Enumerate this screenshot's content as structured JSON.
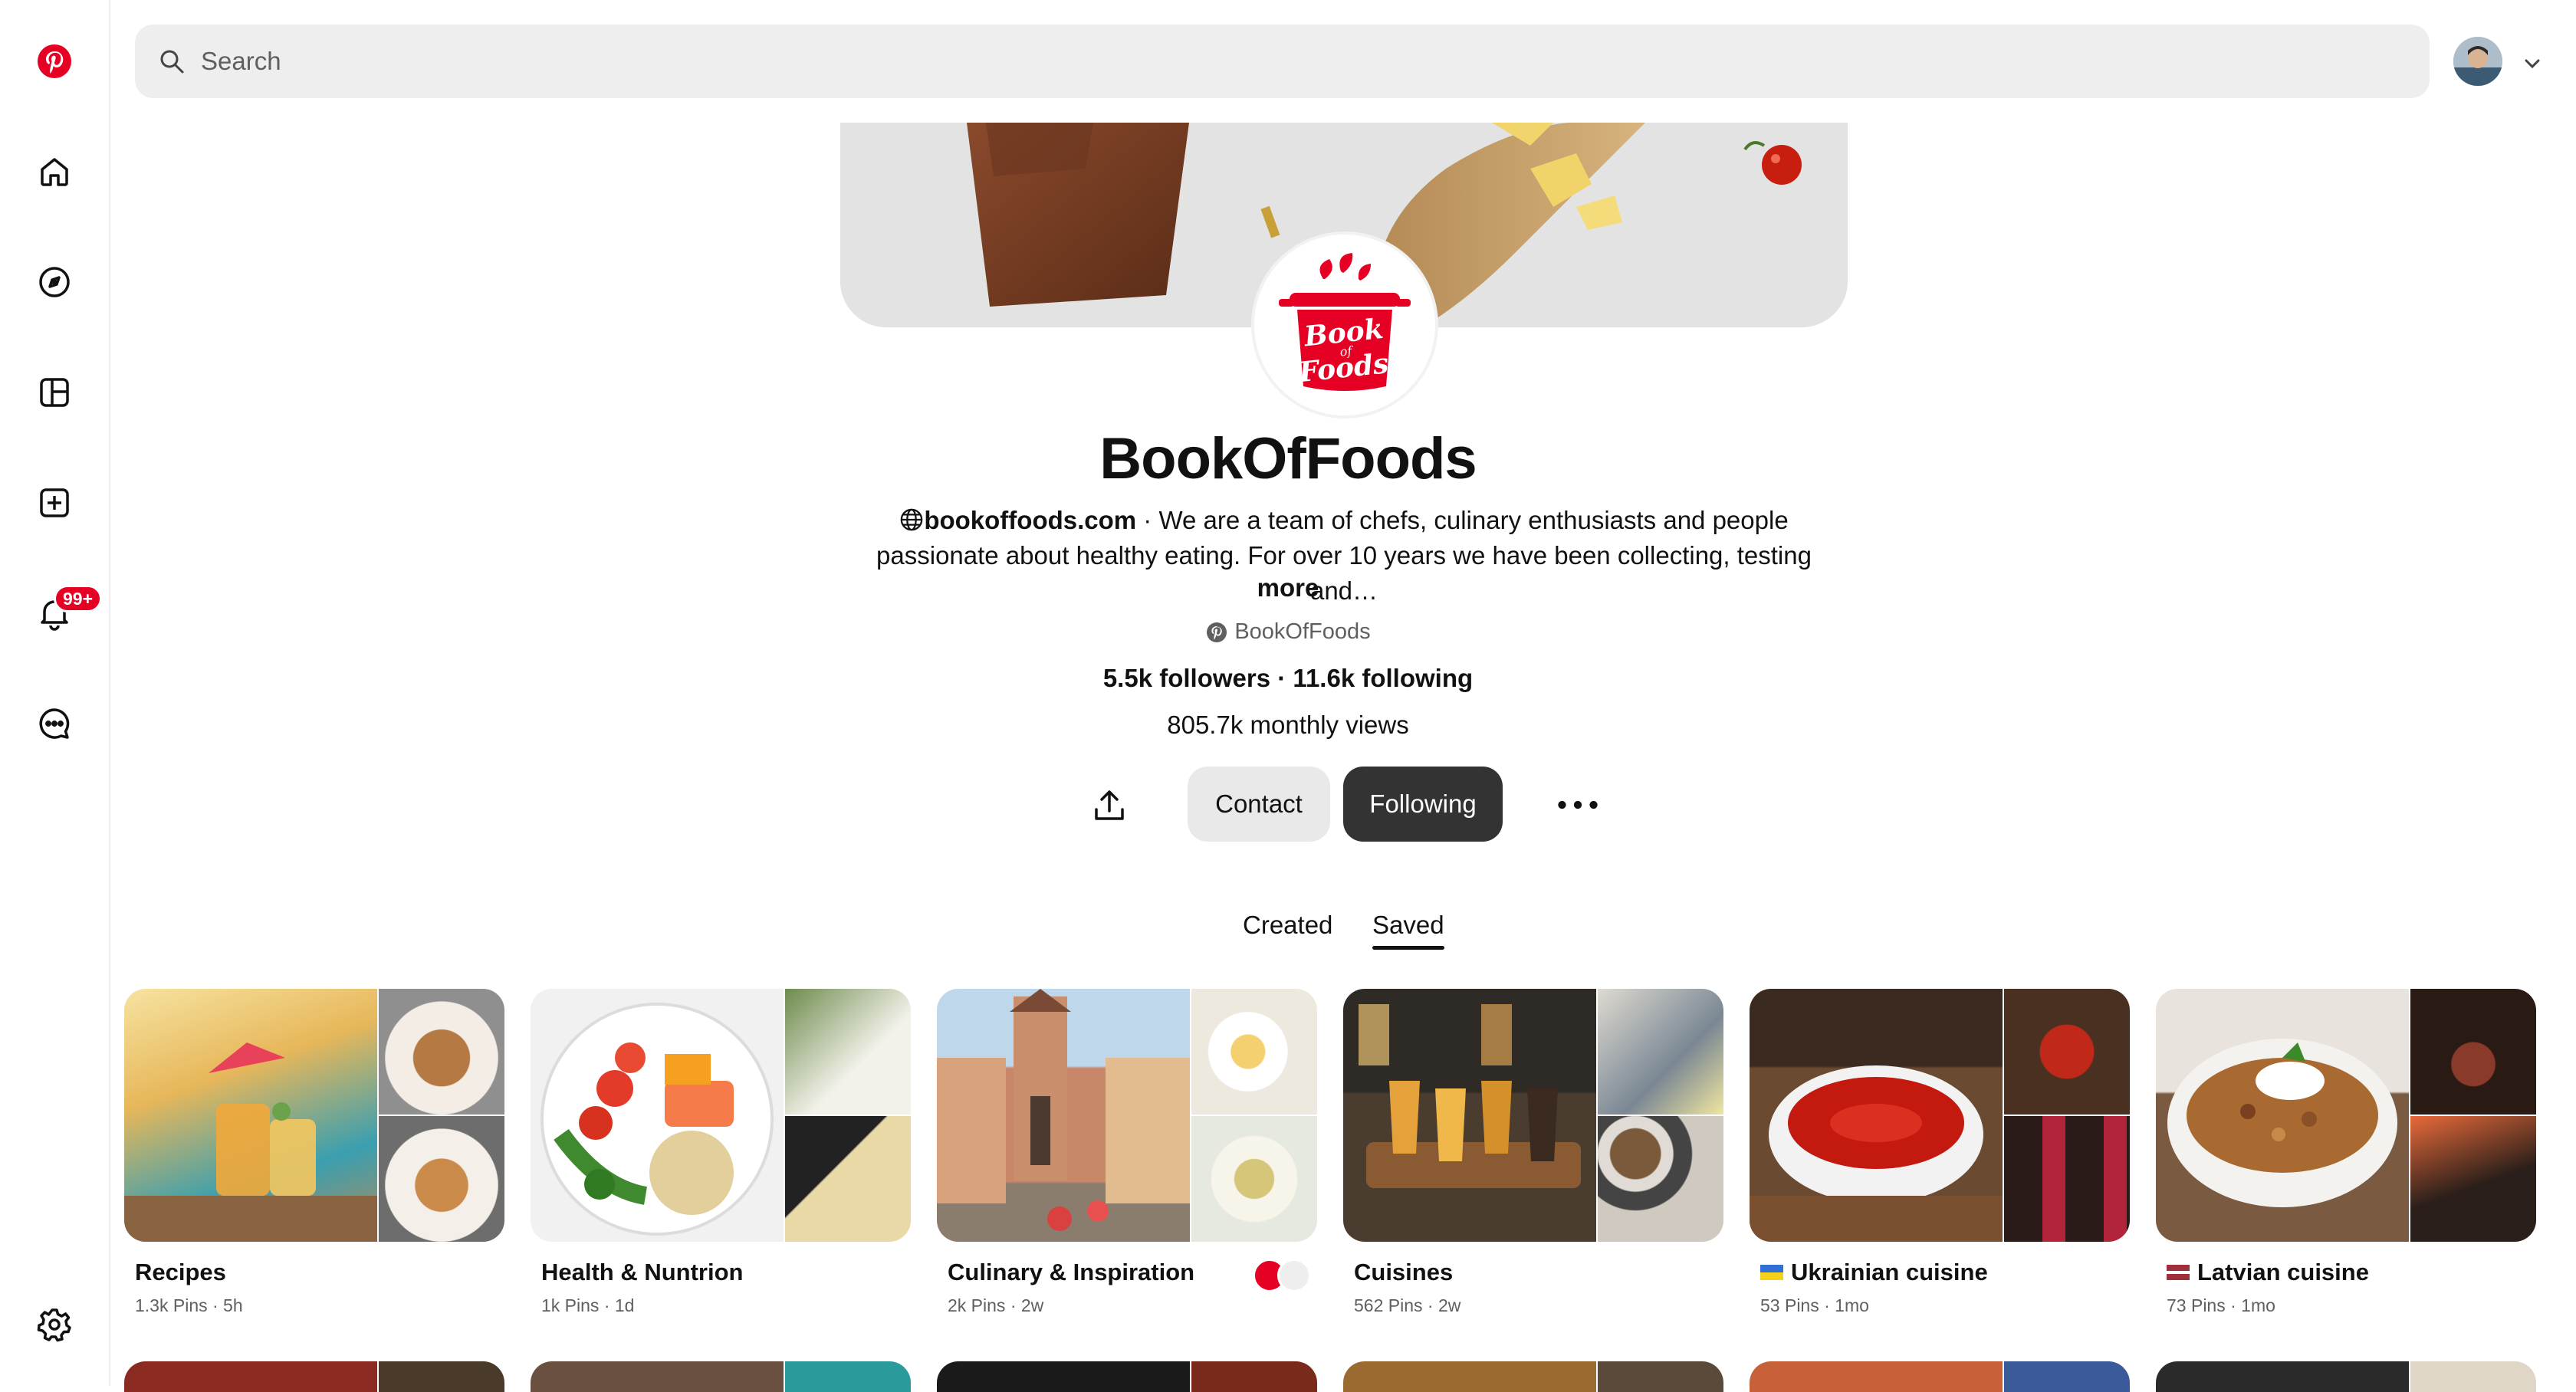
{
  "search": {
    "placeholder": "Search"
  },
  "nav": {
    "notifications_badge": "99+"
  },
  "profile": {
    "name": "BookOfFoods",
    "website": "bookoffoods.com",
    "bio_separator": " · ",
    "bio": "We are a team of chefs, culinary enthusiasts and people passionate about healthy eating. For over 10 years we have been collecting, testing and…",
    "more_label": "more",
    "handle": "BookOfFoods",
    "followers": "5.5k followers",
    "stats_separator": " · ",
    "following": "11.6k following",
    "monthly_views": "805.7k monthly views",
    "contact_label": "Contact",
    "following_button_label": "Following",
    "logo_text_top": "Book",
    "logo_text_mid": "of",
    "logo_text_bottom": "Foods"
  },
  "tabs": {
    "created": "Created",
    "saved": "Saved",
    "active": "Saved"
  },
  "boards": [
    {
      "title": "Recipes",
      "meta": "1.3k Pins · 5h"
    },
    {
      "title": "Health & Nuntrion",
      "meta": "1k Pins · 1d"
    },
    {
      "title": "Culinary & Inspiration",
      "meta": "2k Pins · 2w"
    },
    {
      "title": "Cuisines",
      "meta": "562 Pins · 2w"
    },
    {
      "title": "Ukrainian cuisine",
      "meta": "53 Pins · 1mo"
    },
    {
      "title": "Latvian cuisine",
      "meta": "73 Pins · 1mo"
    }
  ],
  "colors": {
    "brand": "#e60023",
    "following_button": "#333333",
    "contact_button": "#e9e9e9",
    "search_bg": "#eeeeee",
    "meta_text": "#5f5f5f"
  },
  "icons": [
    "pinterest-logo-icon",
    "home-icon",
    "explore-icon",
    "dashboard-icon",
    "create-icon",
    "notifications-icon",
    "messages-icon",
    "settings-icon",
    "search-icon",
    "chevron-down-icon",
    "share-icon",
    "more-icon",
    "globe-icon",
    "pinterest-small-icon"
  ]
}
